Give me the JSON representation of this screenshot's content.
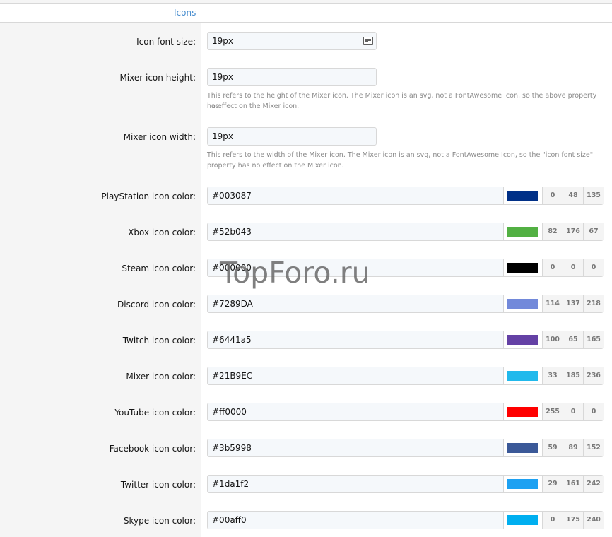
{
  "section": {
    "title": "Icons"
  },
  "fields": {
    "icon_font_size": {
      "label": "Icon font size:",
      "value": "19px"
    },
    "mixer_height": {
      "label": "Mixer icon height:",
      "value": "19px",
      "hint_line1": "This refers to the height of the Mixer icon. The Mixer icon is an svg, not a FontAwesome Icon, so the above property has",
      "hint_line2": "no effect on the Mixer icon."
    },
    "mixer_width": {
      "label": "Mixer icon width:",
      "value": "19px",
      "hint_line1": "This refers to the width of the Mixer icon. The Mixer icon is an svg, not a FontAwesome Icon, so the \"icon font size\"",
      "hint_line2": "property has no effect on the Mixer icon."
    }
  },
  "colors": [
    {
      "label": "PlayStation icon color:",
      "hex": "#003087",
      "swatch": "#003087",
      "r": "0",
      "g": "48",
      "b": "135"
    },
    {
      "label": "Xbox icon color:",
      "hex": "#52b043",
      "swatch": "#52b043",
      "r": "82",
      "g": "176",
      "b": "67"
    },
    {
      "label": "Steam icon color:",
      "hex": "#000000",
      "swatch": "#000000",
      "r": "0",
      "g": "0",
      "b": "0"
    },
    {
      "label": "Discord icon color:",
      "hex": "#7289DA",
      "swatch": "#7289DA",
      "r": "114",
      "g": "137",
      "b": "218"
    },
    {
      "label": "Twitch icon color:",
      "hex": "#6441a5",
      "swatch": "#6441a5",
      "r": "100",
      "g": "65",
      "b": "165"
    },
    {
      "label": "Mixer icon color:",
      "hex": "#21B9EC",
      "swatch": "#21B9EC",
      "r": "33",
      "g": "185",
      "b": "236"
    },
    {
      "label": "YouTube icon color:",
      "hex": "#ff0000",
      "swatch": "#ff0000",
      "r": "255",
      "g": "0",
      "b": "0"
    },
    {
      "label": "Facebook icon color:",
      "hex": "#3b5998",
      "swatch": "#3b5998",
      "r": "59",
      "g": "89",
      "b": "152"
    },
    {
      "label": "Twitter icon color:",
      "hex": "#1da1f2",
      "swatch": "#1da1f2",
      "r": "29",
      "g": "161",
      "b": "242"
    },
    {
      "label": "Skype icon color:",
      "hex": "#00aff0",
      "swatch": "#00aff0",
      "r": "0",
      "g": "175",
      "b": "240"
    }
  ],
  "watermark": "TopForo.ru",
  "accent_color": "#4a8fd0",
  "icons": {
    "units": "units-toggle-icon"
  }
}
